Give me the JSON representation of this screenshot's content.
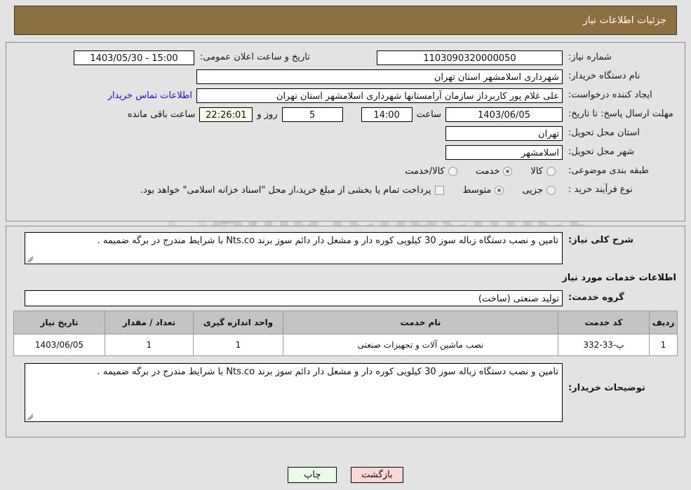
{
  "header": {
    "title": "جزئیات اطلاعات نیاز",
    "bg_color": "#8c6f41"
  },
  "watermark": {
    "text_left": "Ania",
    "text_right": "Tender.net",
    "icon": "shield-icon"
  },
  "fields": {
    "need_number_label": "شماره نیاز:",
    "need_number_value": "1103090320000050",
    "announce_label": "تاریخ و ساعت اعلان عمومی:",
    "announce_value": "15:00 - 1403/05/30",
    "buyer_org_label": "نام دستگاه خریدار:",
    "buyer_org_value": "شهرداری اسلامشهر استان تهران",
    "creator_label": "ایجاد کننده درخواست:",
    "creator_value": "علی غلام پور کاربرداز سازمان آرامستانها شهرداری اسلامشهر استان تهران",
    "contact_link": "اطلاعات تماس خریدار",
    "deadline_label": "مهلت ارسال پاسخ: تا تاریخ:",
    "deadline_date": "1403/06/05",
    "hour_word": "ساعت",
    "deadline_time": "14:00",
    "days_left": "5",
    "days_word": "روز و",
    "timer": "22:26:01",
    "timer_suffix": "ساعت باقی مانده",
    "province_label": "استان محل تحویل:",
    "province_value": "تهران",
    "city_label": "شهر محل تحویل:",
    "city_value": "اسلامشهر",
    "category_label": "طبقه بندی موضوعی:",
    "process_label": "نوع فرآیند خرید :",
    "treasury_note": "پرداخت تمام یا بخشی از مبلغ خرید،از محل \"اسناد خزانه اسلامی\" خواهد بود."
  },
  "category_options": [
    {
      "label": "کالا",
      "selected": false
    },
    {
      "label": "خدمت",
      "selected": true
    },
    {
      "label": "کالا/خدمت",
      "selected": false
    }
  ],
  "process_options": [
    {
      "label": "جزیی",
      "selected": false
    },
    {
      "label": "متوسط",
      "selected": true
    }
  ],
  "summary": {
    "label": "شرح کلی نیاز:",
    "value": "تامین و نصب دستگاه زباله سوز 30 کیلویی کوره دار و مشعل دار دائم سوز برند Nts.co با شرایط مندرج در برگه ضمیمه ."
  },
  "services_section": {
    "title": "اطلاعات خدمات مورد نیاز",
    "group_label": "گروه خدمت:",
    "group_value": "تولید صنعتی (ساخت)"
  },
  "table": {
    "headers": [
      "ردیف",
      "کد خدمت",
      "نام خدمت",
      "واحد اندازه گیری",
      "تعداد / مقدار",
      "تاریخ نیاز"
    ],
    "rows": [
      {
        "index": "1",
        "code": "پ-33-332",
        "name": "نصب ماشین آلات و تجهیزات صنعتی",
        "unit": "1",
        "qty": "1",
        "date": "1403/06/05"
      }
    ]
  },
  "buyer_notes": {
    "label": "توضیحات خریدار:",
    "value": "تامین و نصب دستگاه زباله سوز 30 کیلویی کوره دار و مشعل دار دائم سوز برند Nts.co با شرایط مندرج در برگه ضمیمه ."
  },
  "footer": {
    "print_label": "چاپ",
    "back_label": "بازگشت"
  }
}
